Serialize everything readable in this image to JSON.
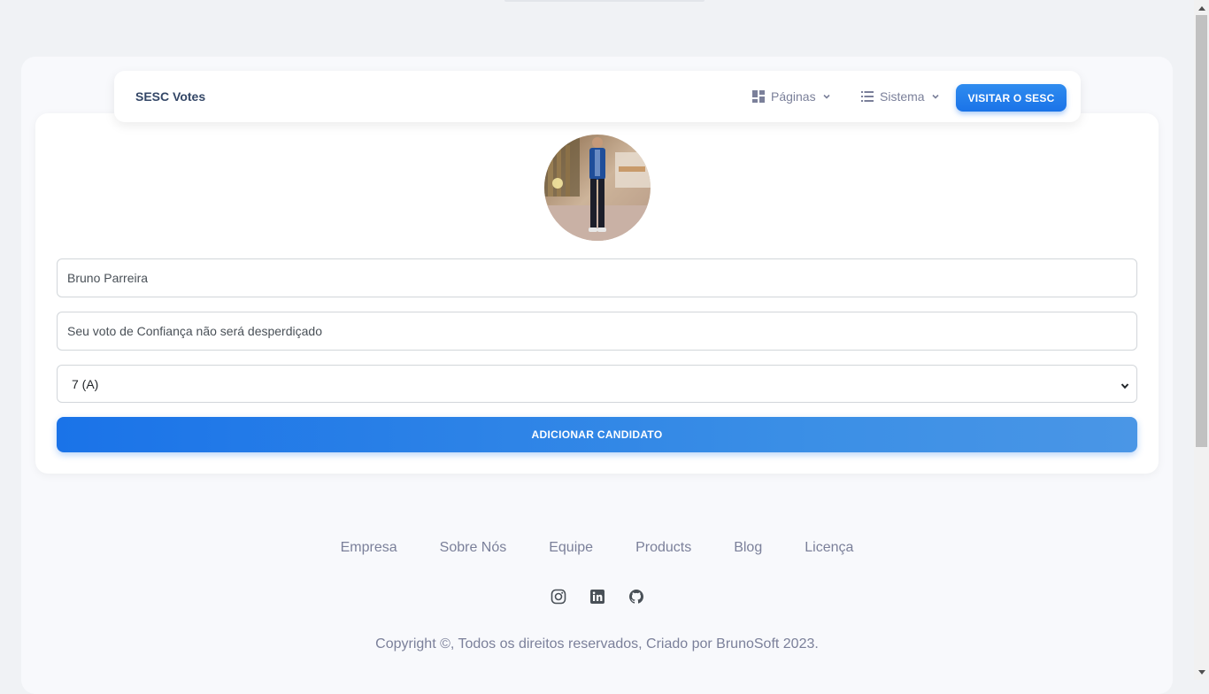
{
  "navbar": {
    "brand": "SESC Votes",
    "menu": [
      {
        "label": "Páginas",
        "icon": "dashboard-icon"
      },
      {
        "label": "Sistema",
        "icon": "list-icon"
      }
    ],
    "visit_button": "VISITAR O SESC"
  },
  "form": {
    "avatar_alt": "candidate-photo",
    "name_value": "Bruno Parreira",
    "motto_value": "Seu voto de Confiança não será desperdiçado",
    "class_selected": "7 (A)",
    "submit_label": "ADICIONAR CANDIDATO"
  },
  "footer": {
    "links": [
      "Empresa",
      "Sobre Nós",
      "Equipe",
      "Products",
      "Blog",
      "Licença"
    ],
    "socials": [
      "instagram-icon",
      "linkedin-icon",
      "github-icon"
    ],
    "copyright": "Copyright ©, Todos os direitos reservados, Criado por BrunoSoft 2023."
  },
  "colors": {
    "primary": "#1a73e8",
    "text_dark": "#344767",
    "text_muted": "#7b809a",
    "background": "#f0f2f5"
  }
}
